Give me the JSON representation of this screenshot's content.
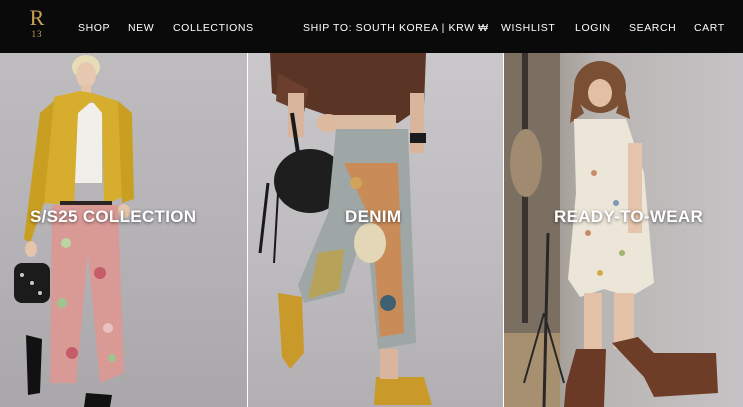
{
  "brand": {
    "logo_letter": "R",
    "logo_number": "13"
  },
  "nav": {
    "shop": "SHOP",
    "new": "NEW",
    "collections": "COLLECTIONS",
    "ship_to": "SHIP TO: SOUTH KOREA | KRW ₩",
    "wishlist": "WISHLIST",
    "login": "LOGIN",
    "search": "SEARCH",
    "cart": "CART"
  },
  "panels": [
    {
      "title": "S/S25 COLLECTION"
    },
    {
      "title": "DENIM"
    },
    {
      "title": "READY-TO-WEAR"
    }
  ],
  "colors": {
    "header_bg": "#0a0a0a",
    "logo_gold": "#c8a253",
    "text_white": "#ffffff"
  }
}
